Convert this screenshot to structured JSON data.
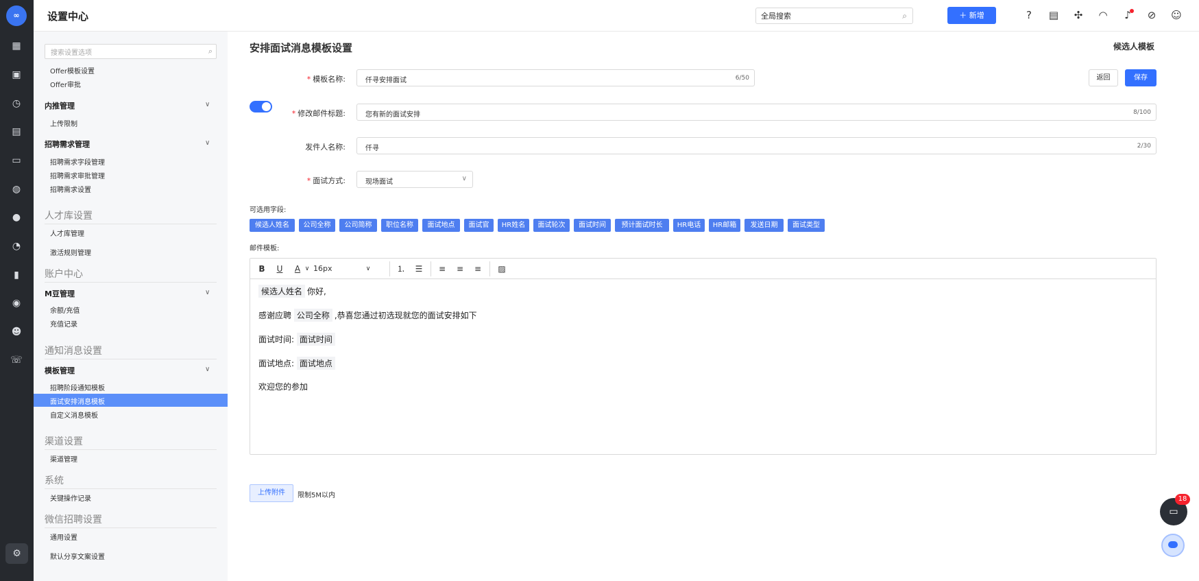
{
  "app": {
    "logo_text": "∞",
    "title": "设置中心"
  },
  "topbar": {
    "search_placeholder": "全局搜索",
    "new_button": "新增",
    "icons": [
      "help-icon",
      "document-icon",
      "plugin-icon",
      "headset-icon",
      "bell-icon",
      "link-icon",
      "user-icon"
    ]
  },
  "rail": {
    "icons": [
      "dashboard-icon",
      "briefcase-icon",
      "clock-doc-icon",
      "calendar-icon",
      "id-card-icon",
      "wechat-icon",
      "bookmark-icon",
      "pie-chart-icon",
      "bar-chart-icon",
      "compass-icon",
      "people-icon",
      "phone-icon",
      "settings-icon"
    ]
  },
  "sidebar": {
    "search_placeholder": "搜索设置选项",
    "items": {
      "offer_template": "Offer模板设置",
      "offer_approval": "Offer审批",
      "referral_group": "内推管理",
      "upload_limit": "上传限制",
      "demand_group": "招聘需求管理",
      "demand_fields": "招聘需求字段管理",
      "demand_approval": "招聘需求审批管理",
      "demand_settings": "招聘需求设置",
      "talent_header": "人才库设置",
      "talent_manage": "人才库管理",
      "activation_rules": "激活规则管理",
      "account_header": "账户中心",
      "mbean_group": "M豆管理",
      "balance": "余额/充值",
      "recharge_log": "充值记录",
      "notify_header": "通知消息设置",
      "template_group": "模板管理",
      "stage_template": "招聘阶段通知模板",
      "interview_template": "面试安排消息模板",
      "custom_template": "自定义消息模板",
      "channel_header": "渠道设置",
      "channel_manage": "渠道管理",
      "system_header": "系统",
      "key_op_log": "关键操作记录",
      "wechat_header": "微信招聘设置",
      "general": "通用设置",
      "share_copy": "默认分享文案设置"
    }
  },
  "main": {
    "title": "安排面试消息模板设置",
    "candidate_template": "候选人模板",
    "back_button": "返回",
    "save_button": "保存",
    "template_name": {
      "label": "模板名称:",
      "value": "仟寻安排面试",
      "count": "6/50"
    },
    "mail_subject": {
      "label": "修改邮件标题:",
      "value": "您有新的面试安排",
      "count": "8/100",
      "toggle_on": true
    },
    "sender_name": {
      "label": "发件人名称:",
      "value": "仟寻",
      "count": "2/30"
    },
    "interview_mode": {
      "label": "面试方式:",
      "value": "现场面试"
    },
    "fields_label": "可选用字段:",
    "fields": [
      "候选人姓名",
      "公司全称",
      "公司简称",
      "职位名称",
      "面试地点",
      "面试官",
      "HR姓名",
      "面试轮次",
      "面试时间",
      "预计面试时长",
      "HR电话",
      "HR邮箱",
      "发送日期",
      "面试类型"
    ],
    "mail_template_label": "邮件模板:",
    "editor": {
      "font_size": "16px",
      "line1_tag": "候选人姓名",
      "line1_text": "你好,",
      "line2_pre": "感谢应聘",
      "line2_tag": "公司全称",
      "line2_post": ",恭喜您通过初选现就您的面试安排如下",
      "line3_label": "面试时间:",
      "line3_tag": "面试时间",
      "line4_label": "面试地点:",
      "line4_tag": "面试地点",
      "line5": "欢迎您的参加"
    },
    "upload_button": "上传附件",
    "upload_limit": "限制5M以内"
  },
  "chat": {
    "badge": "18"
  },
  "colors": {
    "primary": "#3370ff",
    "rail": "#26292e",
    "sidebar_active": "#5b8ff9",
    "chip": "#4e7ef0"
  }
}
